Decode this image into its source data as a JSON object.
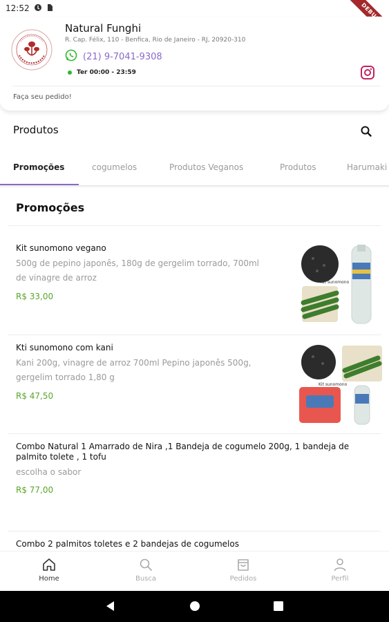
{
  "status_bar": {
    "time": "12:52"
  },
  "debug_banner": "DEBUG",
  "store": {
    "name": "Natural Funghi",
    "address": "R. Cap. Félix, 110 - Benfica, Rio de Janeiro - RJ, 20920-310",
    "phone": "(21) 9-7041-9308",
    "hours": "Ter 00:00 - 23:59",
    "order_prompt": "Faça seu pedido!",
    "logo_ring_text": "NATURAL FUNGHI"
  },
  "products_bar": {
    "title": "Produtos"
  },
  "tabs": [
    {
      "label": "Promoções",
      "active": true
    },
    {
      "label": "cogumelos"
    },
    {
      "label": "Produtos Veganos"
    },
    {
      "label": "Produtos"
    },
    {
      "label": "Harumaki"
    }
  ],
  "section": {
    "title": "Promoções"
  },
  "products": [
    {
      "name": "Kit sunomono vegano",
      "description_lines": [
        "500g de pepino japonês, 180g de gergelim torrado, 700ml",
        "de vinagre de arroz"
      ],
      "price": "R$ 33,00",
      "thumb_label": "Kit sunomono"
    },
    {
      "name": "Kti sunomono com kani",
      "description_lines": [
        "Kani 200g, vinagre de arroz 700ml Pepino japonês 500g,",
        "gergelim torrado 1,80 g"
      ],
      "price": "R$ 47,50",
      "thumb_label": "Kit sunomono"
    },
    {
      "name_lines": [
        "Combo Natural 1 Amarrado de Nira ,1 Bandeja de cogumelo 200g, 1 bandeja de",
        "palmito tolete , 1 tofu"
      ],
      "description_lines": [
        "escolha o sabor"
      ],
      "price": "R$ 77,00"
    },
    {
      "name": "Combo 2 palmitos toletes e 2 bandejas de cogumelos"
    }
  ],
  "bottom_nav": [
    {
      "label": "Home",
      "icon": "home-icon",
      "active": true
    },
    {
      "label": "Busca",
      "icon": "search-icon"
    },
    {
      "label": "Pedidos",
      "icon": "bag-icon"
    },
    {
      "label": "Perfil",
      "icon": "person-icon"
    }
  ],
  "colors": {
    "accent": "#8a68c8",
    "price": "#58a62a",
    "status_online": "#2eb82e",
    "logo_red": "#b32a2a",
    "debug": "#a4282b"
  }
}
